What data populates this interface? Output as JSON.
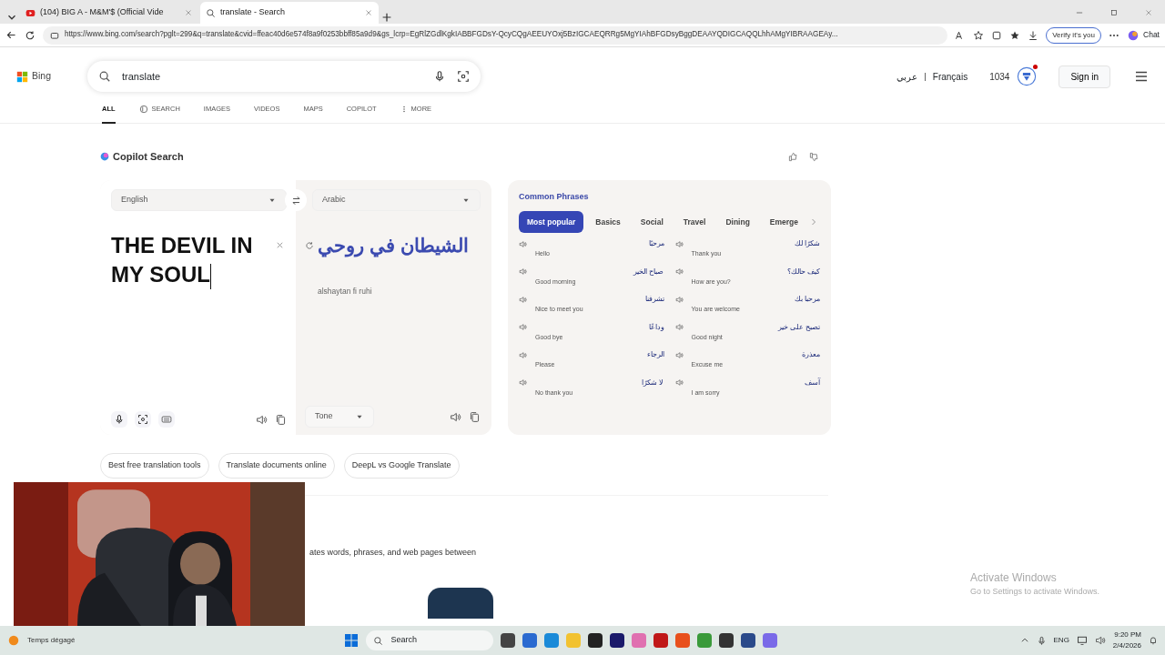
{
  "browser": {
    "tabs": [
      {
        "title": "(104) BIG A - M&M'$ (Official Vide",
        "kind": "video",
        "selected": false
      },
      {
        "title": "translate - Search",
        "kind": "search",
        "selected": true
      }
    ],
    "url": "https://www.bing.com/search?pglt=299&q=translate&cvid=ffeac40d6e574f8a9f0253bbff85a9d9&gs_lcrp=EgRlZGdlKgkIABBFGDsY-QcyCQgAEEUYOxj5BzIGCAEQRRg5MgYIAhBFGDsyBggDEAAYQDIGCAQQLhhAMgYIBRAAGEAy...",
    "verify": "Verify it's you",
    "chat": "Chat"
  },
  "header": {
    "logo": "Bing",
    "query": "translate",
    "languages": [
      "عربي",
      "Français"
    ],
    "points": "1034",
    "notification": true,
    "sign_in": "Sign in"
  },
  "nav": [
    {
      "label": "ALL",
      "kind": "text",
      "selected": true
    },
    {
      "label": "SEARCH",
      "kind": "copilot",
      "selected": false
    },
    {
      "label": "IMAGES",
      "kind": "text",
      "selected": false
    },
    {
      "label": "VIDEOS",
      "kind": "text",
      "selected": false
    },
    {
      "label": "MAPS",
      "kind": "text",
      "selected": false
    },
    {
      "label": "COPILOT",
      "kind": "text",
      "selected": false
    },
    {
      "label": "MORE",
      "kind": "more",
      "selected": false
    }
  ],
  "copilot": {
    "title": "Copilot Search"
  },
  "translator": {
    "source_lang": "English",
    "target_lang": "Arabic",
    "input": "THE DEVIL IN MY SOUL",
    "output": "الشيطان في روحي",
    "transliteration": "alshaytan fi ruhi",
    "tone": "Tone"
  },
  "phrases": {
    "title": "Common Phrases",
    "tabs": [
      {
        "label": "Most popular",
        "selected": true
      },
      {
        "label": "Basics",
        "selected": false
      },
      {
        "label": "Social",
        "selected": false
      },
      {
        "label": "Travel",
        "selected": false
      },
      {
        "label": "Dining",
        "selected": false
      },
      {
        "label": "Emerge",
        "selected": false
      }
    ],
    "items": [
      {
        "arabic": "مرحبًا",
        "english": "Hello"
      },
      {
        "arabic": "شكرًا لك",
        "english": "Thank you"
      },
      {
        "arabic": "صباح الخير",
        "english": "Good morning"
      },
      {
        "arabic": "كيف حالك؟",
        "english": "How are you?"
      },
      {
        "arabic": "تشرفنا",
        "english": "Nice to meet you"
      },
      {
        "arabic": "مرحبا بك",
        "english": "You are welcome"
      },
      {
        "arabic": "وداعًا",
        "english": "Good bye"
      },
      {
        "arabic": "تصبح على خير",
        "english": "Good night"
      },
      {
        "arabic": "الرجاء",
        "english": "Please"
      },
      {
        "arabic": "معذرة",
        "english": "Excuse me"
      },
      {
        "arabic": "لا شكرًا",
        "english": "No thank you"
      },
      {
        "arabic": "آسف",
        "english": "I am sorry"
      }
    ]
  },
  "related": [
    "Best free translation tools",
    "Translate documents online",
    "DeepL vs Google Translate"
  ],
  "snippet": "ates words, phrases, and web pages between",
  "activation": {
    "title": "Activate Windows",
    "subtitle": "Go to Settings to activate Windows."
  },
  "taskbar": {
    "weather": "Temps dégagé",
    "search": "Search",
    "language": "ENG",
    "time": "9:20 PM",
    "date": "2/4/2026"
  }
}
